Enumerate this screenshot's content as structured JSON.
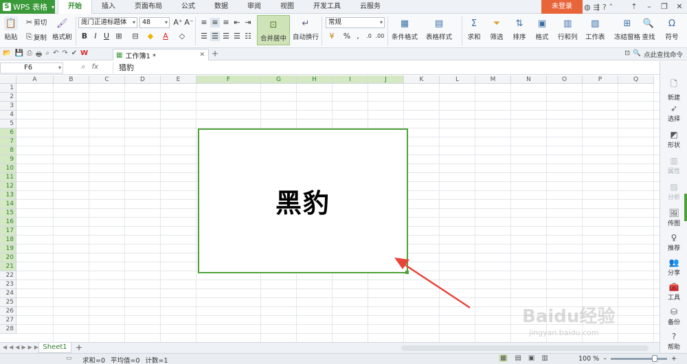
{
  "app": {
    "logo_text": "WPS 表格",
    "menu_tabs": [
      "开始",
      "插入",
      "页面布局",
      "公式",
      "数据",
      "审阅",
      "视图",
      "开发工具",
      "云服务"
    ],
    "login_label": "未登录"
  },
  "ribbon": {
    "paste": "粘贴",
    "cut": "剪切",
    "copy": "复制",
    "format_painter": "格式刷",
    "font_name": "庞门正道标题体",
    "font_size": "48",
    "merge_center": "合并居中",
    "wrap_text": "自动换行",
    "number_format": "常规",
    "conditional_format": "条件格式",
    "table_style": "表格样式",
    "sum": "求和",
    "filter": "筛选",
    "sort": "排序",
    "format": "格式",
    "rows_cols": "行和列",
    "worksheet": "工作表",
    "freeze": "冻结窗格",
    "find": "查找",
    "symbol": "符号"
  },
  "docbar": {
    "doc_tab": "工作簿1 *",
    "find_command": "点此查找命令"
  },
  "formula_bar": {
    "cell_ref": "F6",
    "fx": "fx",
    "content": "猎豹"
  },
  "grid": {
    "columns": [
      "A",
      "B",
      "C",
      "D",
      "E",
      "F",
      "G",
      "H",
      "I",
      "J",
      "K",
      "L",
      "M",
      "N",
      "O",
      "P",
      "Q"
    ],
    "rows": [
      "1",
      "2",
      "3",
      "4",
      "5",
      "6",
      "7",
      "8",
      "9",
      "10",
      "11",
      "12",
      "13",
      "14",
      "15",
      "16",
      "17",
      "18",
      "19",
      "20",
      "21",
      "22",
      "23",
      "24",
      "25",
      "26",
      "27",
      "28"
    ],
    "selected_columns": [
      "F",
      "G",
      "H",
      "I",
      "J"
    ],
    "selected_rows": [
      "6",
      "7",
      "8",
      "9",
      "10",
      "11",
      "12",
      "13",
      "14",
      "15",
      "16",
      "17",
      "18",
      "19",
      "20",
      "21"
    ],
    "merged_cell_text": "黑豹"
  },
  "sheets": {
    "tabs": [
      "Sheet1"
    ]
  },
  "status": {
    "sum": "求和=0",
    "average": "平均值=0",
    "count": "计数=1",
    "zoom": "100 %"
  },
  "side_panel": {
    "items": [
      "新建",
      "选择",
      "形状",
      "属性",
      "分析",
      "传图",
      "推荐",
      "分享",
      "工具",
      "备份",
      "帮助"
    ]
  },
  "watermark": {
    "brand": "Baidu经验",
    "url": "jingyan.baidu.com"
  },
  "colors": {
    "accent": "#4ea03a",
    "login": "#e8653a",
    "selected_header": "#d4e8c4"
  }
}
